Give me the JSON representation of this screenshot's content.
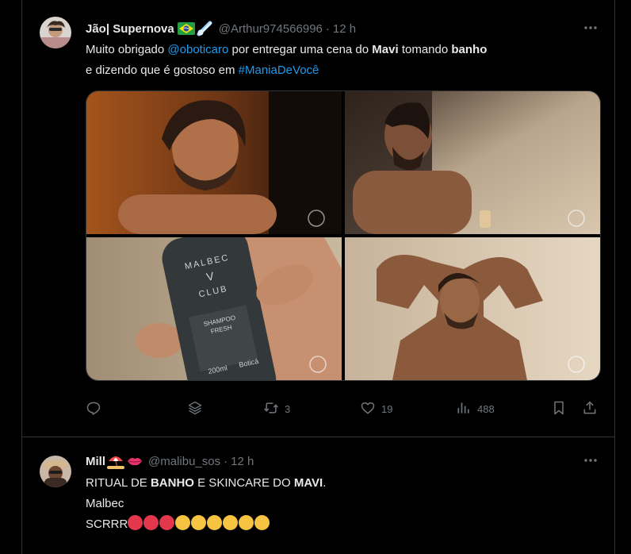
{
  "tweet1": {
    "author": {
      "name": "Jão| Supernova",
      "name_emojis": [
        "brazil-flag-icon",
        "comet-icon"
      ],
      "handle": "@Arthur974566996",
      "separator": "·",
      "time": "12 h"
    },
    "text": {
      "line1_a": "Muito obrigado ",
      "mention": "@oboticaro",
      "line1_b": " por entregar uma cena do ",
      "bold1": "Mavi",
      "line1_c": " tomando ",
      "bold2": "banho",
      "line2_a": "e dizendo que é gostoso em ",
      "hashtag": "#ManiaDeVocê"
    },
    "media": [
      {
        "name": "man-at-mirror-photo"
      },
      {
        "name": "man-spraying-perfume-photo"
      },
      {
        "name": "malbec-club-shampoo-photo",
        "bottle_text": [
          "MALBEC",
          "V",
          "CLUB",
          "SHAMPOO",
          "FRESH",
          "200ml",
          "Boticá"
        ]
      },
      {
        "name": "man-in-shower-photo"
      }
    ],
    "actions": {
      "reply": {
        "icon": "reply-icon",
        "count": ""
      },
      "grok": {
        "icon": "layers-icon"
      },
      "repost": {
        "icon": "repost-icon",
        "count": "3"
      },
      "like": {
        "icon": "heart-icon",
        "count": "19"
      },
      "views": {
        "icon": "views-icon",
        "count": "488"
      },
      "bookmark": {
        "icon": "bookmark-icon"
      },
      "share": {
        "icon": "share-icon"
      }
    }
  },
  "tweet2": {
    "author": {
      "name": "Mill",
      "name_emojis": [
        "beach-umbrella-icon",
        "lips-icon"
      ],
      "handle": "@malibu_sos",
      "separator": "·",
      "time": "12 h"
    },
    "text": {
      "line1_a": "RITUAL DE ",
      "bold1": "BANHO",
      "line1_b": " E SKINCARE DO ",
      "bold2": "MAVI",
      "line1_c": ".",
      "line2": "Malbec",
      "line3": "SCRRR",
      "line3_emojis": [
        "hot-face-icon",
        "hot-face-icon",
        "hot-face-icon",
        "relieved-face-icon",
        "relieved-face-icon",
        "relieved-face-icon",
        "relieved-face-icon",
        "relieved-face-icon",
        "relieved-face-icon"
      ]
    }
  },
  "colors": {
    "background": "#000000",
    "text": "#e7e9ea",
    "muted": "#71767b",
    "link": "#1d9bf0",
    "border": "#2f3336"
  }
}
